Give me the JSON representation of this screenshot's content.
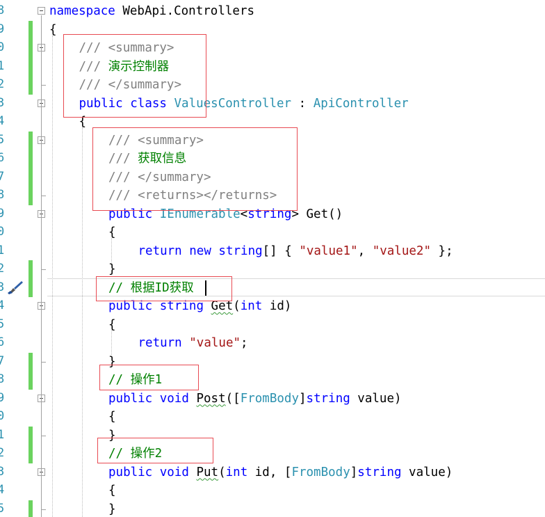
{
  "editor": {
    "lines": [
      {
        "num": "8",
        "changed": false,
        "fold": true,
        "indent": 0,
        "tokens": [
          [
            "kw",
            "namespace"
          ],
          [
            "tx",
            " WebApi.Controllers"
          ]
        ]
      },
      {
        "num": "9",
        "changed": true,
        "fold": false,
        "indent": 0,
        "tokens": [
          [
            "tx",
            "{"
          ]
        ]
      },
      {
        "num": "0",
        "changed": true,
        "fold": true,
        "indent": 1,
        "tokens": [
          [
            "cg",
            "/// <summary>"
          ]
        ]
      },
      {
        "num": "1",
        "changed": true,
        "fold": false,
        "indent": 1,
        "tokens": [
          [
            "cg",
            "/// "
          ],
          [
            "cm",
            "演示控制器"
          ]
        ]
      },
      {
        "num": "2",
        "changed": true,
        "fold": false,
        "indent": 1,
        "tokens": [
          [
            "cg",
            "/// </summary>"
          ]
        ]
      },
      {
        "num": "3",
        "changed": false,
        "fold": true,
        "indent": 1,
        "tokens": [
          [
            "kw",
            "public"
          ],
          [
            "tx",
            " "
          ],
          [
            "kw",
            "class"
          ],
          [
            "tx",
            " "
          ],
          [
            "ty",
            "ValuesController"
          ],
          [
            "tx",
            " : "
          ],
          [
            "ty",
            "ApiController"
          ]
        ]
      },
      {
        "num": "4",
        "changed": false,
        "fold": false,
        "indent": 1,
        "tokens": [
          [
            "tx",
            "{"
          ]
        ]
      },
      {
        "num": "5",
        "changed": true,
        "fold": true,
        "indent": 2,
        "tokens": [
          [
            "cg",
            "/// <summary>"
          ]
        ]
      },
      {
        "num": "6",
        "changed": true,
        "fold": false,
        "indent": 2,
        "tokens": [
          [
            "cg",
            "/// "
          ],
          [
            "cm",
            "获取信息"
          ]
        ]
      },
      {
        "num": "7",
        "changed": true,
        "fold": false,
        "indent": 2,
        "tokens": [
          [
            "cg",
            "/// </summary>"
          ]
        ]
      },
      {
        "num": "8",
        "changed": true,
        "fold": false,
        "indent": 2,
        "tokens": [
          [
            "cg",
            "/// <returns></returns>"
          ]
        ]
      },
      {
        "num": "9",
        "changed": false,
        "fold": true,
        "indent": 2,
        "tokens": [
          [
            "kw",
            "public"
          ],
          [
            "tx",
            " "
          ],
          [
            "ty",
            "IEnumerable"
          ],
          [
            "tx",
            "<"
          ],
          [
            "kw",
            "string"
          ],
          [
            "tx",
            "> Get()"
          ]
        ]
      },
      {
        "num": "0",
        "changed": false,
        "fold": false,
        "indent": 2,
        "tokens": [
          [
            "tx",
            "{"
          ]
        ]
      },
      {
        "num": "1",
        "changed": false,
        "fold": false,
        "indent": 3,
        "tokens": [
          [
            "kw",
            "return"
          ],
          [
            "tx",
            " "
          ],
          [
            "kw",
            "new"
          ],
          [
            "tx",
            " "
          ],
          [
            "kw",
            "string"
          ],
          [
            "tx",
            "[] { "
          ],
          [
            "st",
            "\"value1\""
          ],
          [
            "tx",
            ", "
          ],
          [
            "st",
            "\"value2\""
          ],
          [
            "tx",
            " };"
          ]
        ]
      },
      {
        "num": "2",
        "changed": true,
        "fold": false,
        "indent": 2,
        "tokens": [
          [
            "tx",
            "}"
          ]
        ]
      },
      {
        "num": "3",
        "changed": true,
        "fold": false,
        "indent": 2,
        "tokens": [
          [
            "cm",
            "// 根据ID获取"
          ]
        ]
      },
      {
        "num": "4",
        "changed": false,
        "fold": true,
        "indent": 2,
        "tokens": [
          [
            "kw",
            "public"
          ],
          [
            "tx",
            " "
          ],
          [
            "kw",
            "string"
          ],
          [
            "tx",
            " "
          ],
          [
            "sq",
            "Get"
          ],
          [
            "tx",
            "("
          ],
          [
            "kw",
            "int"
          ],
          [
            "tx",
            " id)"
          ]
        ]
      },
      {
        "num": "5",
        "changed": false,
        "fold": false,
        "indent": 2,
        "tokens": [
          [
            "tx",
            "{"
          ]
        ]
      },
      {
        "num": "6",
        "changed": false,
        "fold": false,
        "indent": 3,
        "tokens": [
          [
            "kw",
            "return"
          ],
          [
            "tx",
            " "
          ],
          [
            "st",
            "\"value\""
          ],
          [
            "tx",
            ";"
          ]
        ]
      },
      {
        "num": "7",
        "changed": true,
        "fold": false,
        "indent": 2,
        "tokens": [
          [
            "tx",
            "}"
          ]
        ]
      },
      {
        "num": "8",
        "changed": true,
        "fold": false,
        "indent": 2,
        "tokens": [
          [
            "cm",
            "// 操作1"
          ]
        ]
      },
      {
        "num": "9",
        "changed": false,
        "fold": true,
        "indent": 2,
        "tokens": [
          [
            "kw",
            "public"
          ],
          [
            "tx",
            " "
          ],
          [
            "kw",
            "void"
          ],
          [
            "tx",
            " "
          ],
          [
            "sq",
            "Post"
          ],
          [
            "tx",
            "(["
          ],
          [
            "ty",
            "FromBody"
          ],
          [
            "tx",
            "]"
          ],
          [
            "kw",
            "string"
          ],
          [
            "tx",
            " value)"
          ]
        ]
      },
      {
        "num": "0",
        "changed": false,
        "fold": false,
        "indent": 2,
        "tokens": [
          [
            "tx",
            "{"
          ]
        ]
      },
      {
        "num": "1",
        "changed": true,
        "fold": false,
        "indent": 2,
        "tokens": [
          [
            "tx",
            "}"
          ]
        ]
      },
      {
        "num": "2",
        "changed": true,
        "fold": false,
        "indent": 2,
        "tokens": [
          [
            "cm",
            "// 操作2"
          ]
        ]
      },
      {
        "num": "3",
        "changed": false,
        "fold": true,
        "indent": 2,
        "tokens": [
          [
            "kw",
            "public"
          ],
          [
            "tx",
            " "
          ],
          [
            "kw",
            "void"
          ],
          [
            "tx",
            " "
          ],
          [
            "sq",
            "Put"
          ],
          [
            "tx",
            "("
          ],
          [
            "kw",
            "int"
          ],
          [
            "tx",
            " id, ["
          ],
          [
            "ty",
            "FromBody"
          ],
          [
            "tx",
            "]"
          ],
          [
            "kw",
            "string"
          ],
          [
            "tx",
            " value)"
          ]
        ]
      },
      {
        "num": "4",
        "changed": false,
        "fold": false,
        "indent": 2,
        "tokens": [
          [
            "tx",
            "{"
          ]
        ]
      },
      {
        "num": "5",
        "changed": true,
        "fold": false,
        "indent": 2,
        "tokens": [
          [
            "tx",
            "}"
          ]
        ]
      }
    ],
    "current_line_index": 15,
    "gutter_icon": "paintbrush-icon",
    "colors": {
      "keyword": "#0000ff",
      "type": "#2b91af",
      "comment": "#008000",
      "doc_comment": "#808080",
      "string": "#a31515",
      "change_bar": "#6bd35f",
      "annotation_box": "#e84a52"
    },
    "annotation_boxes": [
      "doc-summary-class",
      "doc-summary-get",
      "comment-get-by-id",
      "comment-op1",
      "comment-op2"
    ]
  }
}
